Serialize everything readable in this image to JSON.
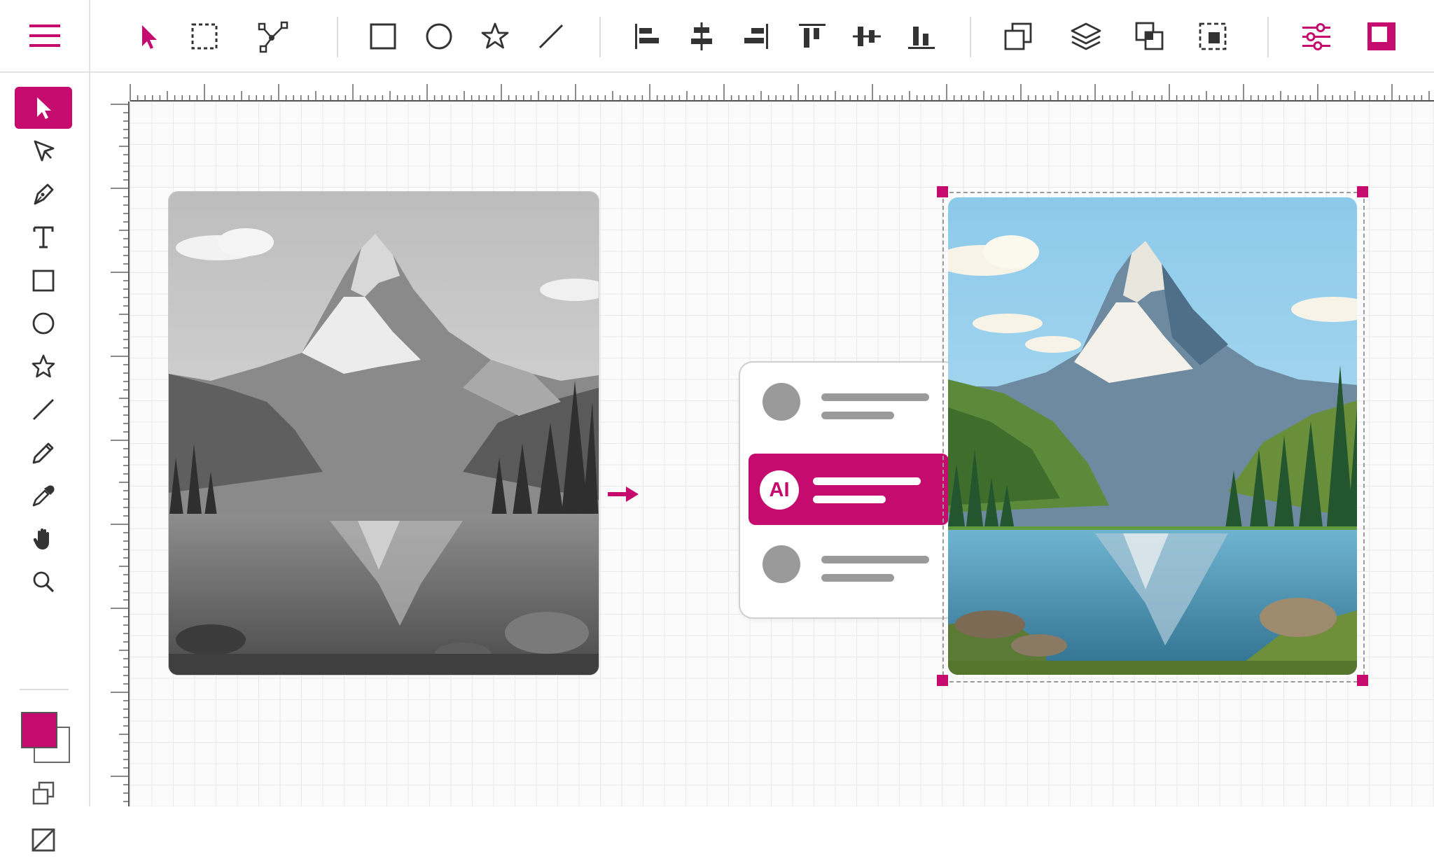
{
  "app": {
    "accent_color": "#c50c6e"
  },
  "toolbar": {
    "menu_icon": "hamburger-menu-icon",
    "tools": [
      "select-arrow-icon",
      "marquee-select-icon",
      "node-path-icon",
      "rectangle-icon",
      "circle-icon",
      "star-icon",
      "line-icon",
      "align-left-icon",
      "align-center-horizontal-icon",
      "align-right-icon",
      "align-top-icon",
      "align-middle-vertical-icon",
      "align-bottom-icon",
      "bring-forward-icon",
      "layers-icon",
      "group-icon",
      "crop-selection-icon",
      "adjustments-sliders-icon",
      "panel-toggle-icon"
    ]
  },
  "sidebar": {
    "tools": [
      "selection-tool-icon",
      "direct-selection-tool-icon",
      "pen-tool-icon",
      "text-tool-icon",
      "rectangle-tool-icon",
      "ellipse-tool-icon",
      "star-tool-icon",
      "line-tool-icon",
      "pencil-tool-icon",
      "eyedropper-tool-icon",
      "hand-tool-icon",
      "zoom-tool-icon"
    ],
    "active_tool": "selection-tool-icon",
    "fill_color": "#c50c6e",
    "stroke_color": "#ffffff"
  },
  "ai_panel": {
    "badge": "AI",
    "rows": [
      "placeholder",
      "ai-action",
      "placeholder"
    ]
  },
  "images": {
    "source": "grayscale-mountain-lake-photo",
    "result": "colorized-mountain-lake-illustration"
  }
}
